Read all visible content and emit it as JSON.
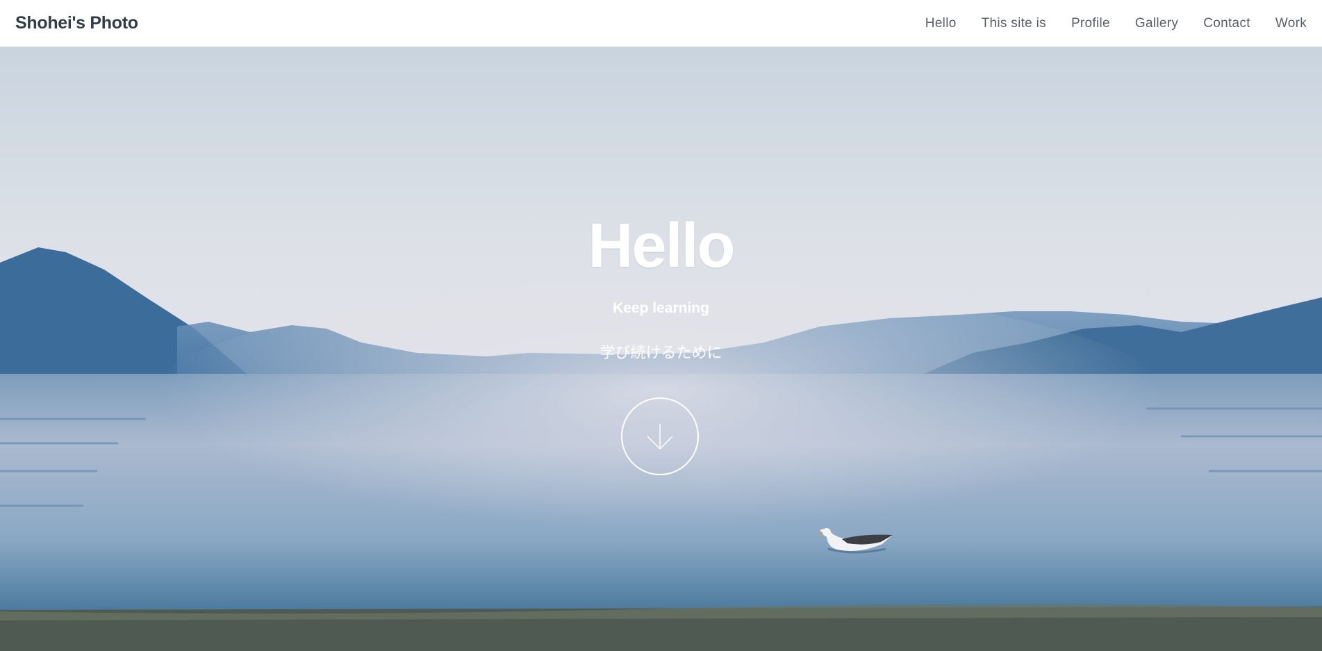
{
  "brand": {
    "name": "Shohei's Photo"
  },
  "nav": {
    "items": [
      {
        "label": "Hello"
      },
      {
        "label": "This site is"
      },
      {
        "label": "Profile"
      },
      {
        "label": "Gallery"
      },
      {
        "label": "Contact"
      },
      {
        "label": "Work"
      }
    ]
  },
  "hero": {
    "title": "Hello",
    "subtitle": "Keep learning",
    "tagline": "学び続けるために",
    "scroll_icon": "arrow-down-icon",
    "background": "lake-landscape-photo"
  },
  "colors": {
    "nav_text": "#5a6168",
    "brand_text": "#333c44",
    "hero_text": "#ffffff"
  }
}
